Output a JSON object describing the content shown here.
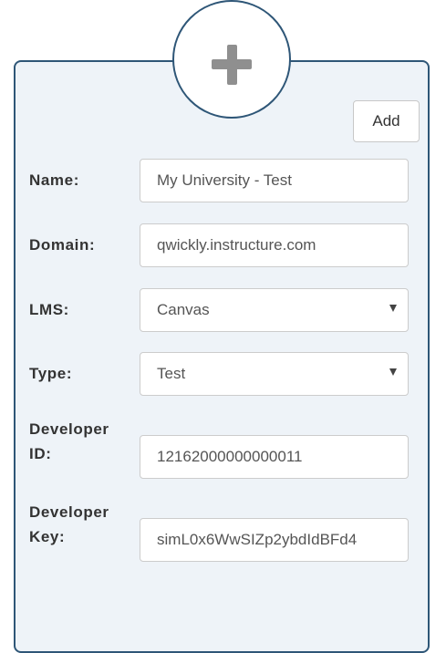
{
  "toolbar": {
    "add_label": "Add"
  },
  "form": {
    "name": {
      "label": "Name:",
      "value": "My University - Test"
    },
    "domain": {
      "label": "Domain:",
      "value": "qwickly.instructure.com"
    },
    "lms": {
      "label": "LMS:",
      "value": "Canvas"
    },
    "type": {
      "label": "Type:",
      "value": "Test"
    },
    "developer_id": {
      "label_line1": "Developer",
      "label_line2": "ID:",
      "value": "12162000000000011"
    },
    "developer_key": {
      "label_line1": "Developer",
      "label_line2": "Key:",
      "value": "simL0x6WwSIZp2ybdIdBFd4"
    }
  },
  "icons": {
    "add": "plus-icon",
    "dropdown": "chevron-down-icon"
  },
  "colors": {
    "panel_background": "#eef3f8",
    "panel_border": "#2e5677",
    "plus_icon": "#8f8f8f"
  }
}
